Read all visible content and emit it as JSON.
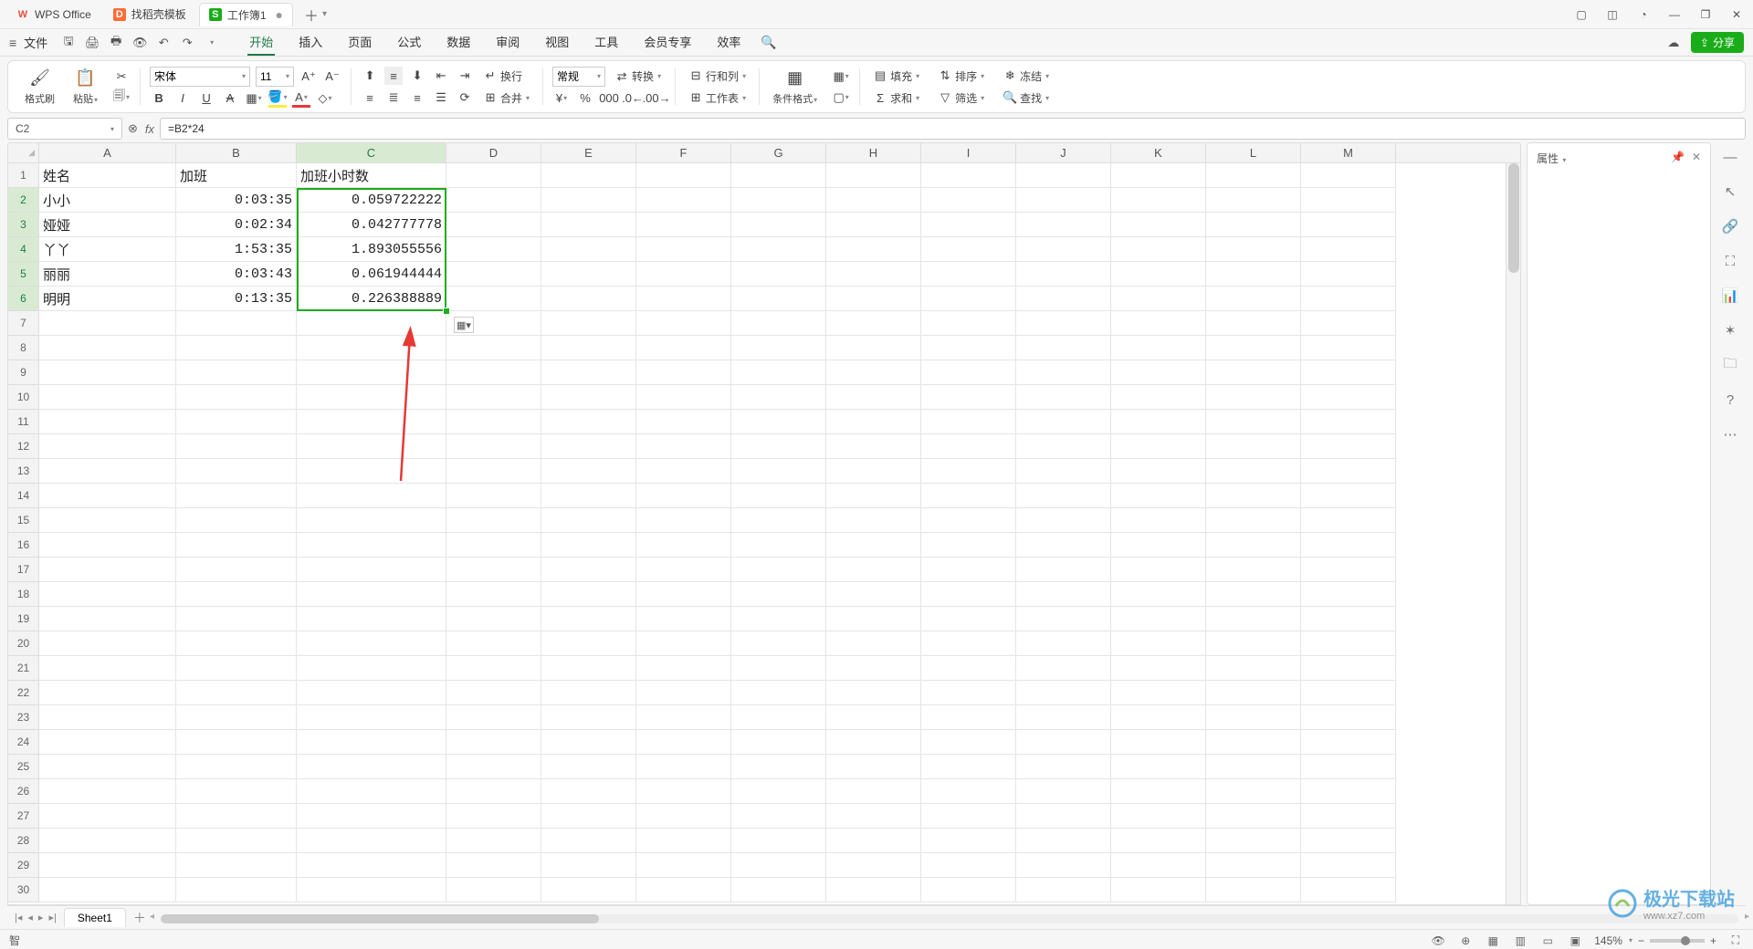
{
  "titlebar": {
    "tabs": [
      {
        "icon": "W",
        "label": "WPS Office",
        "iconClass": "red"
      },
      {
        "icon": "D",
        "label": "找稻壳模板",
        "iconClass": "orange"
      },
      {
        "icon": "S",
        "label": "工作簿1",
        "iconClass": "green",
        "dirty": "●",
        "active": true
      }
    ]
  },
  "menubar": {
    "file_label": "文件",
    "tabs": [
      "开始",
      "插入",
      "页面",
      "公式",
      "数据",
      "审阅",
      "视图",
      "工具",
      "会员专享",
      "效率"
    ],
    "active_tab": "开始",
    "share_label": "分享"
  },
  "ribbon": {
    "format_painter": "格式刷",
    "paste": "粘贴",
    "font_name": "宋体",
    "font_size": "11",
    "wrap": "换行",
    "merge": "合并",
    "number_format": "常规",
    "convert": "转换",
    "rowcol": "行和列",
    "worksheet": "工作表",
    "cond_format": "条件格式",
    "fill": "填充",
    "sort": "排序",
    "freeze": "冻结",
    "sum": "求和",
    "filter": "筛选",
    "find": "查找"
  },
  "formula": {
    "namebox": "C2",
    "formula_text": "=B2*24"
  },
  "grid": {
    "columns": [
      "A",
      "B",
      "C",
      "D",
      "E",
      "F",
      "G",
      "H",
      "I",
      "J",
      "K",
      "L",
      "M"
    ],
    "selected_col": "C",
    "row_count": 30,
    "data": [
      {
        "A": "姓名",
        "B": "加班",
        "C": "加班小时数"
      },
      {
        "A": "小小",
        "B": "0:03:35",
        "C": "0.059722222"
      },
      {
        "A": "娅娅",
        "B": "0:02:34",
        "C": "0.042777778"
      },
      {
        "A": "丫丫",
        "B": "1:53:35",
        "C": "1.893055556"
      },
      {
        "A": "丽丽",
        "B": "0:03:43",
        "C": "0.061944444"
      },
      {
        "A": "明明",
        "B": "0:13:35",
        "C": "0.226388889"
      }
    ],
    "selection": "C2:C6"
  },
  "rightpanel": {
    "properties_label": "属性"
  },
  "sheetbar": {
    "sheet_name": "Sheet1"
  },
  "statusbar": {
    "mode": "智",
    "zoom": "145%"
  },
  "watermark": {
    "brand": "极光下载站",
    "sub": "www.xz7.com"
  },
  "chart_data": {
    "type": "table",
    "title": "加班小时数",
    "columns": [
      "姓名",
      "加班",
      "加班小时数"
    ],
    "rows": [
      [
        "小小",
        "0:03:35",
        0.059722222
      ],
      [
        "娅娅",
        "0:02:34",
        0.042777778
      ],
      [
        "丫丫",
        "1:53:35",
        1.893055556
      ],
      [
        "丽丽",
        "0:03:43",
        0.061944444
      ],
      [
        "明明",
        "0:13:35",
        0.226388889
      ]
    ]
  }
}
